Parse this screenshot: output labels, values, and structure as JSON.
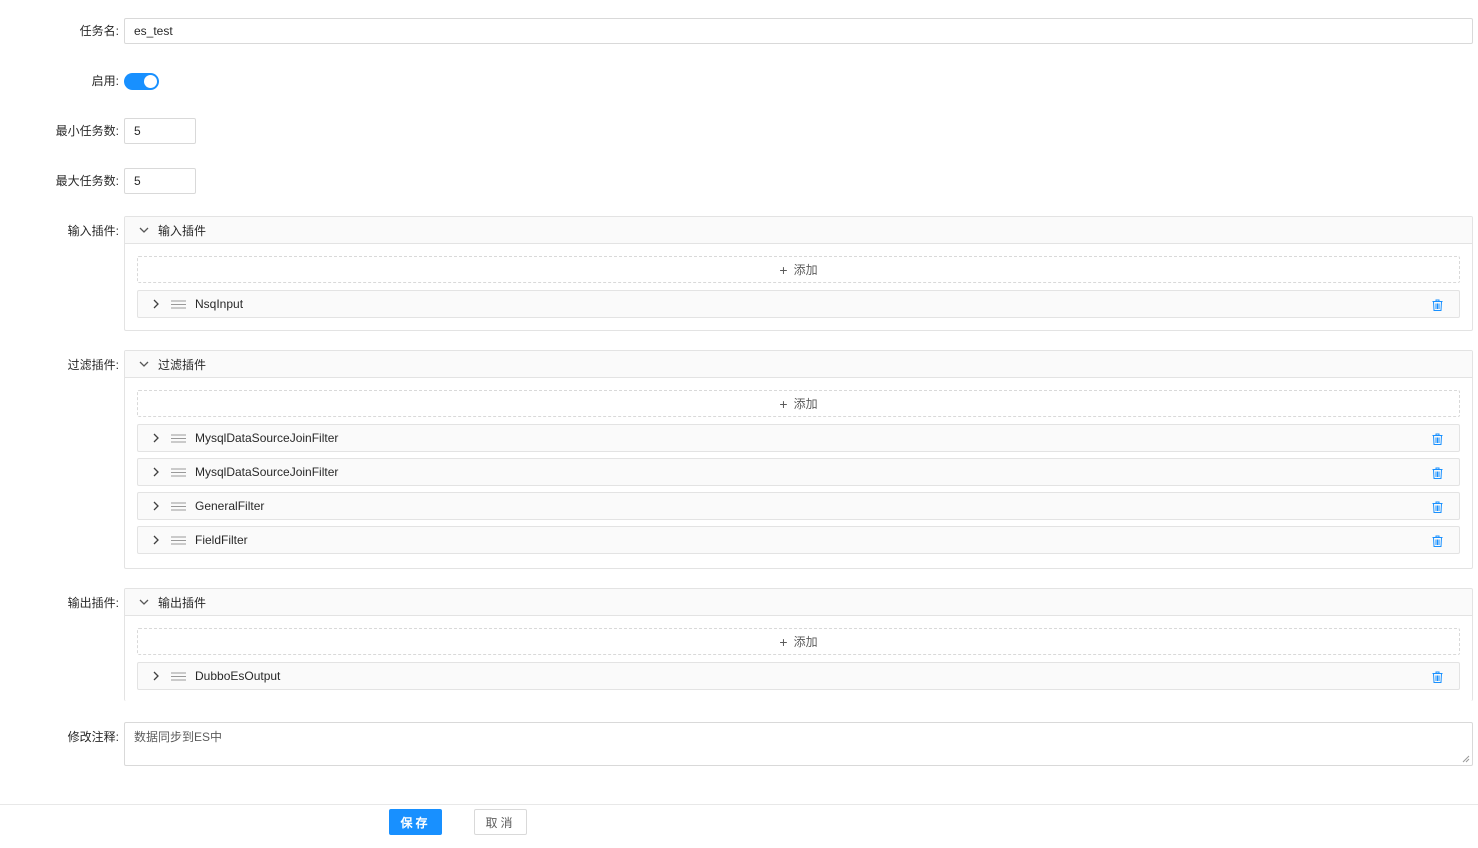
{
  "form": {
    "task_name": {
      "label": "任务名:",
      "value": "es_test"
    },
    "enabled": {
      "label": "启用:",
      "on": true
    },
    "min_tasks": {
      "label": "最小任务数:",
      "value": "5"
    },
    "max_tasks": {
      "label": "最大任务数:",
      "value": "5"
    },
    "input_plugins": {
      "label": "输入插件:",
      "panel_title": "输入插件",
      "add_label": "添加",
      "items": [
        {
          "name": "NsqInput"
        }
      ]
    },
    "filter_plugins": {
      "label": "过滤插件:",
      "panel_title": "过滤插件",
      "add_label": "添加",
      "items": [
        {
          "name": "MysqlDataSourceJoinFilter"
        },
        {
          "name": "MysqlDataSourceJoinFilter"
        },
        {
          "name": "GeneralFilter"
        },
        {
          "name": "FieldFilter"
        }
      ]
    },
    "output_plugins": {
      "label": "输出插件:",
      "panel_title": "输出插件",
      "add_label": "添加",
      "items": [
        {
          "name": "DubboEsOutput"
        }
      ]
    },
    "comment": {
      "label": "修改注释:",
      "value": "数据同步到ES中"
    }
  },
  "footer": {
    "save_label": "保存",
    "cancel_label": "取消"
  },
  "icons": {
    "expand": "chevron-right-icon",
    "collapse": "chevron-down-icon",
    "drag": "drag-handle-icon",
    "delete": "trash-icon",
    "add": "plus-icon"
  },
  "colors": {
    "primary": "#1890ff",
    "delete_icon": "#1890ff",
    "border": "#d9d9d9"
  }
}
